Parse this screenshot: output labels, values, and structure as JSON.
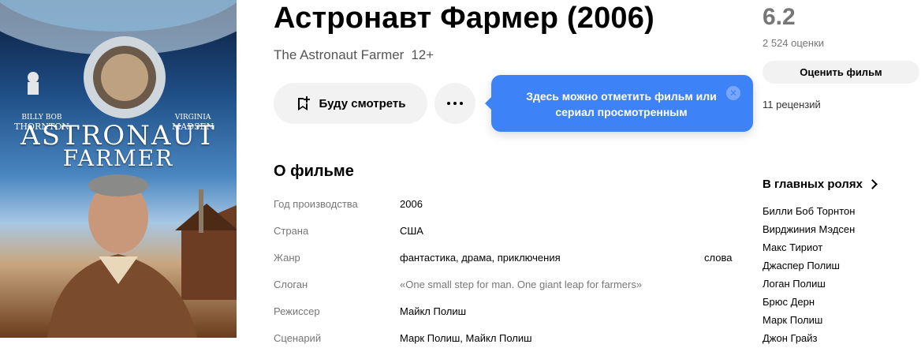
{
  "poster": {
    "actor_left_top": "BILLY BOB",
    "actor_left_bottom": "THORNTON",
    "actor_right_top": "VIRGINIA",
    "actor_right_bottom": "MADSEN",
    "title_line1": "ASTRONAUT",
    "title_line2": "FARMER"
  },
  "film": {
    "title": "Астронавт Фармер (2006)",
    "original_title": "The Astronaut Farmer",
    "age_rating": "12+"
  },
  "actions": {
    "watch_label": "Буду смотреть"
  },
  "tooltip": {
    "text": "Здесь можно отметить фильм или сериал просмотренным",
    "close_glyph": "✕"
  },
  "rating": {
    "value": "6.2",
    "votes": "2 524 оценки",
    "rate_label": "Оценить фильм",
    "reviews": "11 рецензий"
  },
  "about": {
    "heading": "О фильме",
    "rows": [
      {
        "key": "Год производства",
        "value": "2006"
      },
      {
        "key": "Страна",
        "value": "США"
      },
      {
        "key": "Жанр",
        "value": "фантастика, драма, приключения"
      },
      {
        "key": "Слоган",
        "value": "«One small step for man. One giant leap for farmers»"
      },
      {
        "key": "Режиссер",
        "value": "Майкл Полиш"
      },
      {
        "key": "Сценарий",
        "value": "Марк Полиш, Майкл Полиш"
      }
    ],
    "genre_extra": "слова"
  },
  "cast": {
    "heading": "В главных ролях",
    "items": [
      "Билли Боб Торнтон",
      "Вирджиния Мэдсен",
      "Макс Тириот",
      "Джаспер Полиш",
      "Логан Полиш",
      "Брюс Дерн",
      "Марк Полиш",
      "Джон Грайз"
    ]
  },
  "colors": {
    "accent_blue": "#3e82f8",
    "button_bg": "#f2f2f2",
    "muted_text": "#777777"
  }
}
